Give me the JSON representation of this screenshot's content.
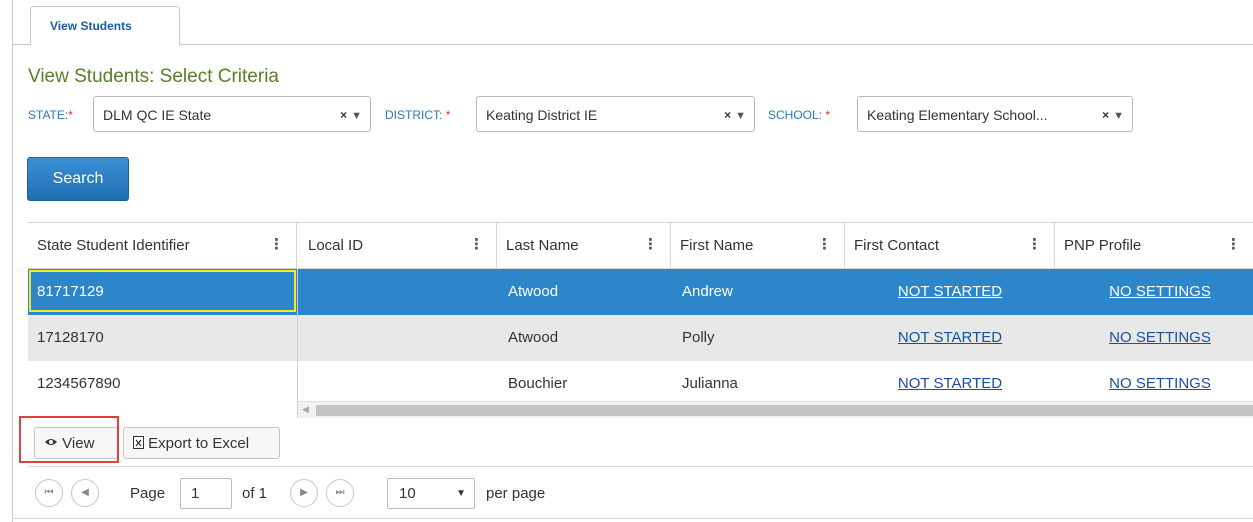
{
  "tab": {
    "label": "View Students"
  },
  "page_title": "View Students: Select Criteria",
  "criteria": {
    "state": {
      "label": "STATE:",
      "required_mark": "*",
      "value": "DLM QC IE State"
    },
    "district": {
      "label": "DISTRICT:",
      "required_mark": "*",
      "value": "Keating District IE"
    },
    "school": {
      "label": "SCHOOL:",
      "required_mark": "*",
      "value": "Keating Elementary School..."
    },
    "clear_glyph": "×",
    "caret_glyph": "▼"
  },
  "search_label": "Search",
  "table": {
    "headers": [
      "State Student Identifier",
      "Local ID",
      "Last Name",
      "First Name",
      "First Contact",
      "PNP Profile"
    ],
    "menu_glyph": "⋮",
    "rows": [
      {
        "ssid": "81717129",
        "local_id": "",
        "last": "Atwood",
        "first": "Andrew",
        "first_contact": "NOT STARTED",
        "pnp": "NO SETTINGS",
        "selected": true
      },
      {
        "ssid": "17128170",
        "local_id": "",
        "last": "Atwood",
        "first": "Polly",
        "first_contact": "NOT STARTED",
        "pnp": "NO SETTINGS",
        "selected": false
      },
      {
        "ssid": "1234567890",
        "local_id": "",
        "last": "Bouchier",
        "first": "Julianna",
        "first_contact": "NOT STARTED",
        "pnp": "NO SETTINGS",
        "selected": false
      }
    ]
  },
  "toolbar": {
    "view_label": "View",
    "export_label": "Export to Excel"
  },
  "pager": {
    "page_label": "Page",
    "page_value": "1",
    "of_label": "of 1",
    "page_size": "10",
    "per_page_label": "per page"
  },
  "colors": {
    "selected_row": "#2c86c9",
    "title_green": "#5a7d2a",
    "link_blue": "#1a4f9c",
    "highlight_red": "#e04040",
    "focus_yellow": "#f2ea2a"
  }
}
